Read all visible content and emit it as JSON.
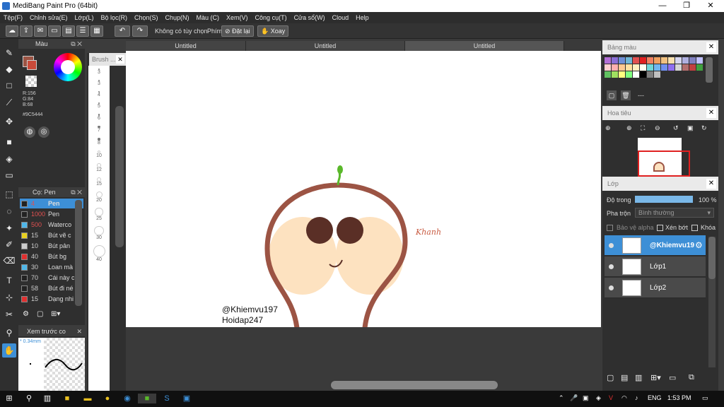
{
  "app": {
    "title": "MediBang Paint Pro (64bit)"
  },
  "menu": [
    "Tệp(F)",
    "Chỉnh sửa(E)",
    "Lớp(L)",
    "Bộ lọc(R)",
    "Chọn(S)",
    "Chụp(N)",
    "Màu (C)",
    "Xem(V)",
    "Công cụ(T)",
    "Cửa sổ(W)",
    "Cloud",
    "Help"
  ],
  "toolbar": {
    "no_options": "Không có tùy chọn",
    "keys_label": "Phím",
    "reset_label": "Đặt lại",
    "rotate_label": "Xoay"
  },
  "color_panel": {
    "title": "Màu",
    "r": "R:156",
    "g": "G:84",
    "b": "B:68",
    "hex": "#9C5444",
    "primary_color": "#9C5444"
  },
  "brush_panel": {
    "title": "Cọ: Pen",
    "items": [
      {
        "size": "4",
        "name": "Pen",
        "color": "#222222"
      },
      {
        "size": "1000",
        "name": "Pen",
        "color": "#222222"
      },
      {
        "size": "500",
        "name": "Waterco",
        "color": "#4fb6e8"
      },
      {
        "size": "15",
        "name": "Bút vẽ c",
        "color": "#e8d020"
      },
      {
        "size": "10",
        "name": "Bút pản",
        "color": "#cccccc"
      },
      {
        "size": "40",
        "name": "Bút bg",
        "color": "#e03030"
      },
      {
        "size": "30",
        "name": "Loan mà",
        "color": "#4fb6e8"
      },
      {
        "size": "70",
        "name": "Cái này c",
        "color": "#222222"
      },
      {
        "size": "58",
        "name": "Bút đi né",
        "color": "#222222"
      },
      {
        "size": "15",
        "name": "Dạng nhi",
        "color": "#e03030"
      }
    ]
  },
  "preview_panel": {
    "title": "Xem trước co",
    "size": "* 0.34mm"
  },
  "brush_strip": {
    "header": "Brush ...",
    "sizes": [
      "3",
      "3",
      "4",
      "5",
      "6",
      "7",
      "8",
      "10",
      "12",
      "15",
      "20",
      "25",
      "30",
      "40"
    ]
  },
  "tabs": [
    "Untitled",
    "Untitled",
    "Untitled"
  ],
  "canvas": {
    "watermark_line1": "@Khiemvu197",
    "watermark_line2": "Hoidap247",
    "signature": "Khanh"
  },
  "palette": {
    "title": "Bảng màu",
    "footer": "---"
  },
  "navigator": {
    "title": "Hoa tiêu"
  },
  "layers": {
    "title": "Lớp",
    "opacity_label": "Độ trong",
    "opacity_value": "100 %",
    "opacity": 1.0,
    "blend_label": "Pha trộn",
    "blend_value": "Bình thường",
    "protect_alpha": "Bảo vệ alpha",
    "clipping": "Xén bớt",
    "lock": "Khóa",
    "items": [
      {
        "name": "@Khiemvu19"
      },
      {
        "name": "Lớp1"
      },
      {
        "name": "Lớp2"
      }
    ]
  },
  "taskbar": {
    "lang": "ENG",
    "time": "1:53 PM"
  }
}
